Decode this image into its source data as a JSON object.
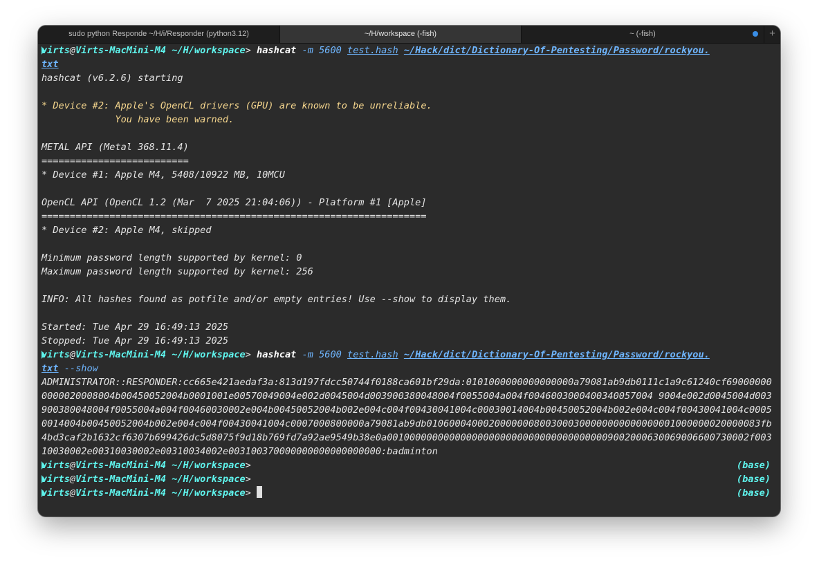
{
  "tabs": [
    {
      "label": "sudo python Responde ~/H/i/Responder (python3.12)"
    },
    {
      "label": "~/H/workspace (-fish)"
    },
    {
      "label": "~ (-fish)"
    }
  ],
  "prompt": {
    "user": "virts",
    "at": "@",
    "host": "Virts-MacMini-M4",
    "path": "~/H/workspace",
    "symbol": ">",
    "env": "(base)"
  },
  "command1": {
    "bin": "hashcat",
    "flag": "-m",
    "mode": "5600",
    "file": "test.hash",
    "wordlist": "~/Hack/dict/Dictionary-Of-Pentesting/Password/rockyou.",
    "wordlist_cont": "txt"
  },
  "output1": [
    "hashcat (v6.2.6) starting",
    "",
    "* Device #2: Apple's OpenCL drivers (GPU) are known to be unreliable.",
    "             You have been warned.",
    "",
    "METAL API (Metal 368.11.4)",
    "==========================",
    "* Device #1: Apple M4, 5408/10922 MB, 10MCU",
    "",
    "OpenCL API (OpenCL 1.2 (Mar  7 2025 21:04:06)) - Platform #1 [Apple]",
    "====================================================================",
    "* Device #2: Apple M4, skipped",
    "",
    "Minimum password length supported by kernel: 0",
    "Maximum password length supported by kernel: 256",
    "",
    "INFO: All hashes found as potfile and/or empty entries! Use --show to display them.",
    "",
    "Started: Tue Apr 29 16:49:13 2025",
    "Stopped: Tue Apr 29 16:49:13 2025"
  ],
  "command2": {
    "bin": "hashcat",
    "flag": "-m",
    "mode": "5600",
    "file": "test.hash",
    "wordlist": "~/Hack/dict/Dictionary-Of-Pentesting/Password/rockyou.",
    "wordlist_cont": "txt",
    "show": "--show"
  },
  "hash_output": "ADMINISTRATOR::RESPONDER:cc665e421aedaf3a:813d197fdcc50744f0188ca601bf29da:0101000000000000000a79081ab9db0111c1a9c61240cf690000000000020008004b00450052004b0001001e00570049004e002d0045004d003900380048004f0055004a004f0046003000400340057004 9004e002d0045004d003900380048004f0055004a004f00460030002e004b00450052004b002e004c004f00430041004c00030014004b00450052004b002e004c004f00430041004c00050014004b00450052004b002e004c004f00430041004c0007000800000a79081ab9db01060004000200000008003000300000000000000001000000020000083fb4bd3caf2b1632cf6307b699426dc5d8075f9d18b769fd7a92ae9549b38e0a0010000000000000000000000000000000000009002000630069006600730002f00310030002e00310030002e00310034002e003100370000000000000000000:badminton"
}
